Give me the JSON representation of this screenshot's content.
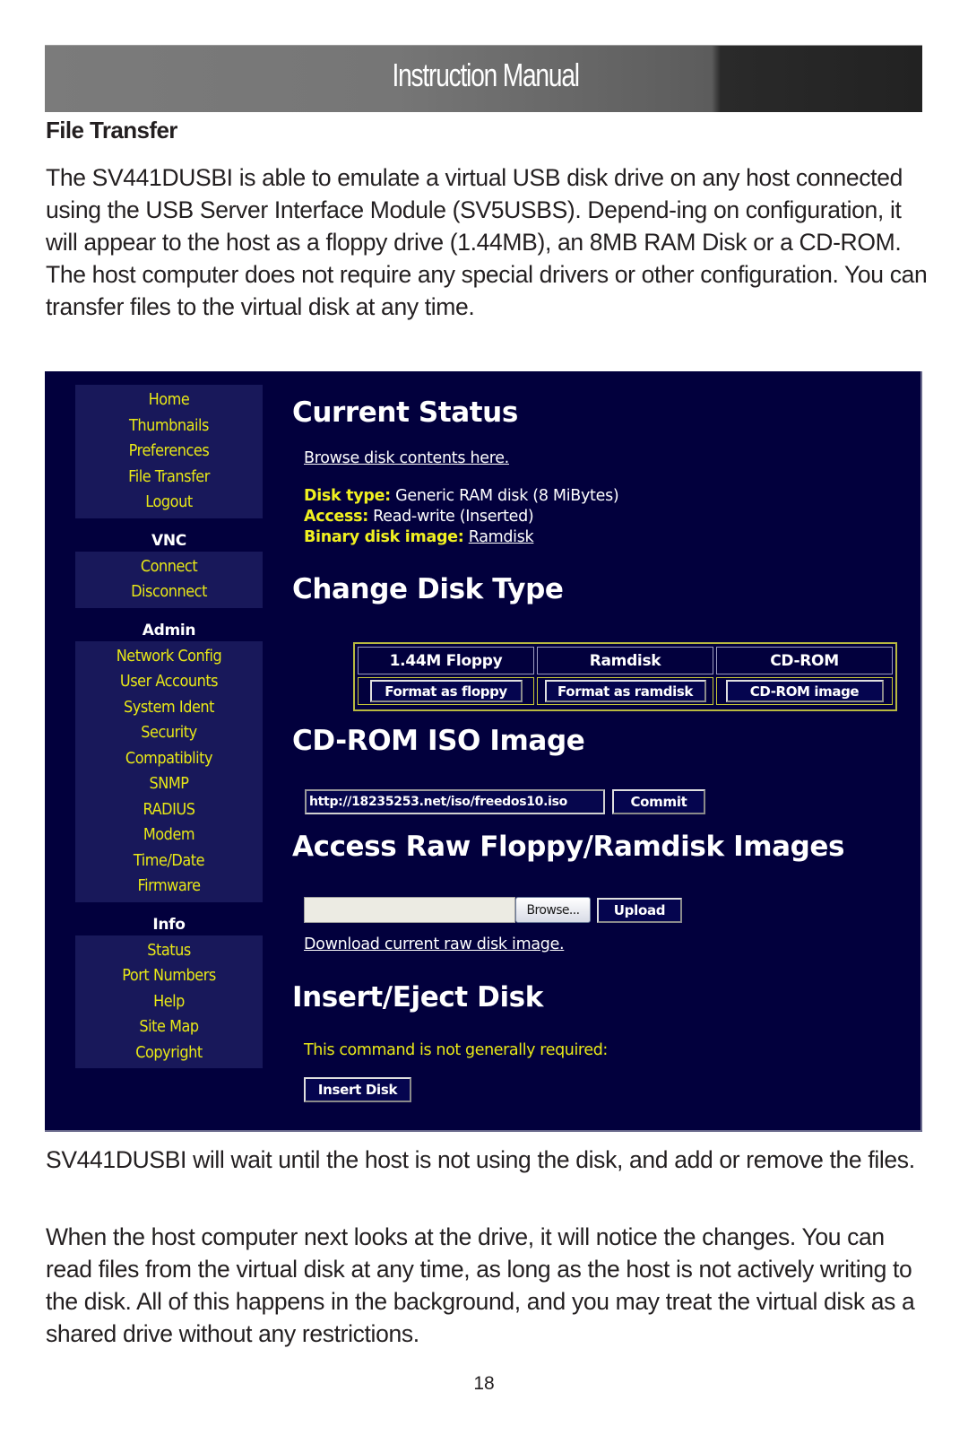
{
  "header": {
    "title": "Instruction Manual"
  },
  "section": {
    "heading": "File Transfer"
  },
  "paragraphs": {
    "intro": "The SV441DUSBI is able to emulate a virtual USB disk drive on any host connected using the USB Server Interface Module (SV5USBS).  Depend-ing on configuration, it will appear to the host as a floppy drive (1.44MB), an 8MB RAM Disk or a CD-ROM. The host computer does not require any special drivers or other configuration. You can transfer files to the virtual disk at any time.",
    "wait": "SV441DUSBI will wait until the host is not using the disk, and add or remove the files.",
    "changes": "When the host computer next looks at the drive, it will notice the changes. You can read files from the virtual disk at any time, as long as the host is not actively writing to the disk. All of this happens in the background, and you may treat the virtual disk as a shared drive without any restrictions."
  },
  "page_number": "18",
  "screenshot": {
    "sidebar": {
      "main_items": [
        "Home",
        "Thumbnails",
        "Preferences",
        "File Transfer",
        "Logout"
      ],
      "vnc": {
        "label": "VNC",
        "items": [
          "Connect",
          "Disconnect"
        ]
      },
      "admin": {
        "label": "Admin",
        "items": [
          "Network Config",
          "User Accounts",
          "System Ident",
          "Security",
          "Compatiblity",
          "SNMP",
          "RADIUS",
          "Modem",
          "Time/Date",
          "Firmware"
        ]
      },
      "info": {
        "label": "Info",
        "items": [
          "Status",
          "Port Numbers",
          "Help",
          "Site Map",
          "Copyright"
        ]
      }
    },
    "current_status": {
      "heading": "Current Status",
      "browse_link": "Browse disk contents here.",
      "disk_type_label": "Disk type:",
      "disk_type_value": "Generic RAM disk (8 MiBytes)",
      "access_label": "Access:",
      "access_value": "Read-write (Inserted)",
      "binary_label": "Binary disk image:",
      "binary_value": "Ramdisk"
    },
    "change_disk_type": {
      "heading": "Change Disk Type",
      "columns": [
        "1.44M Floppy",
        "Ramdisk",
        "CD-ROM"
      ],
      "buttons": [
        "Format as floppy",
        "Format as ramdisk",
        "CD-ROM image"
      ]
    },
    "cdrom_iso": {
      "heading": "CD-ROM ISO Image",
      "url_value": "http://18235253.net/iso/freedos10.iso",
      "commit_label": "Commit"
    },
    "raw_images": {
      "heading": "Access Raw Floppy/Ramdisk Images",
      "file_value": "",
      "browse_label": "Browse...",
      "upload_label": "Upload",
      "download_link": "Download current raw disk image."
    },
    "insert_eject": {
      "heading": "Insert/Eject Disk",
      "note": "This command is not generally required:",
      "insert_label": "Insert Disk"
    }
  }
}
